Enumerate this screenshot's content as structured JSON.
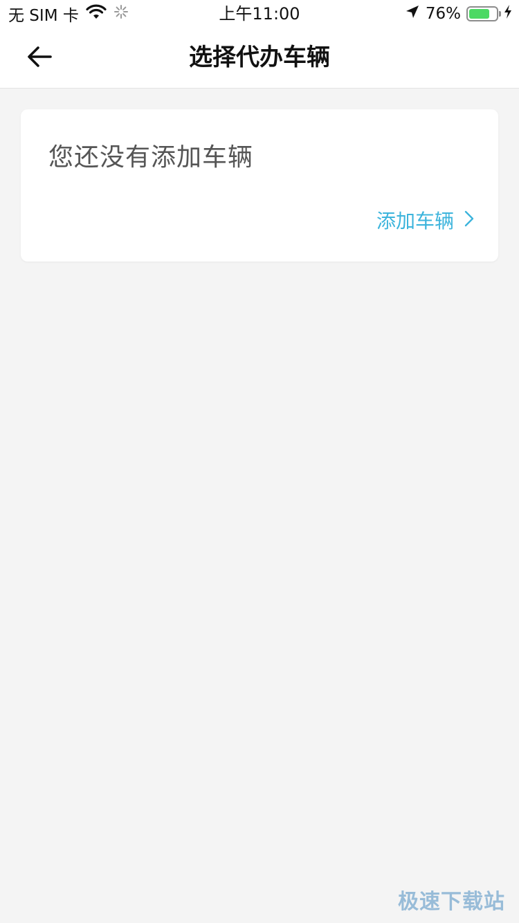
{
  "status_bar": {
    "carrier": "无 SIM 卡",
    "time": "上午11:00",
    "battery_percent": "76%",
    "battery_level": 0.76,
    "icons": [
      "wifi-icon",
      "loading-spinner-icon",
      "location-arrow-icon",
      "battery-icon",
      "charging-bolt-icon"
    ]
  },
  "nav": {
    "title": "选择代办车辆",
    "back_icon": "arrow-left-icon"
  },
  "card": {
    "empty_message": "您还没有添加车辆",
    "add_vehicle_label": "添加车辆",
    "chevron_icon": "chevron-right-icon"
  },
  "watermark": {
    "text": "极速下载站"
  },
  "colors": {
    "accent": "#3cb4dc",
    "background": "#f4f4f4",
    "battery_green": "#4cd964"
  }
}
